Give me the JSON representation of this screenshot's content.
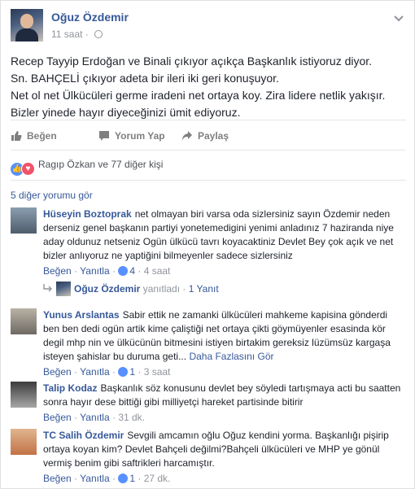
{
  "post": {
    "author": "Oğuz Özdemir",
    "time": "11 saat",
    "dot": "·",
    "lines": [
      "Recep Tayyip Erdoğan ve Binali çıkıyor açıkça Başkanlık istiyoruz diyor.",
      "Sn. BAHÇELİ çıkıyor adeta bir ileri iki geri konuşuyor.",
      "Net ol net Ülkücüleri germe iradeni net ortaya koy. Zira lidere netlik yakışır.",
      "Bizler yinede hayır diyeceğinizi ümit ediyoruz."
    ]
  },
  "actions": {
    "like": "Beğen",
    "comment": "Yorum Yap",
    "share": "Paylaş"
  },
  "reactions": {
    "names": "Ragıp Özkan ve 77 diğer kişi"
  },
  "more_comments": "5 diğer yorumu gör",
  "comments": [
    {
      "name": "Hüseyin Boztoprak",
      "text": "net olmayan biri varsa oda sizlersiniz sayın Özdemir neden derseniz genel başkanın partiyi yonetemedigini yenimi anladınız 7 haziranda niye aday oldunuz netseniz Ogün ülkücü tavrı koyacaktiniz Devlet Bey çok açık ve net bizler anlıyoruz ne yaptiğini bilmeyenler sadece sizlersiniz",
      "like": "Beğen",
      "reply": "Yanıtla",
      "likes": "4",
      "time": "4 saat",
      "sep": "·"
    },
    {
      "name": "Yunus Arslantas",
      "text": "Sabir ettik ne zamanki ülkücüleri mahkeme kapisina gönderdi ben ben dedi ogün artik kime çaliştiği net ortaya çikti göymüyenler esasinda kör degil mhp nin ve ülkücünün bitmesini istiyen birtakim gereksiz lüzümsüz kargaşa isteyen şahislar bu duruma geti...",
      "more": "Daha Fazlasını Gör",
      "like": "Beğen",
      "reply": "Yanıtla",
      "likes": "1",
      "time": "3 saat",
      "sep": "·"
    },
    {
      "name": "Talip Kodaz",
      "text": "Başkanlık söz konusunu devlet bey söyledi tartışmaya acti bu saatten sonra hayır dese bittiği gibi milliyetçi hareket partisinde bitirir",
      "like": "Beğen",
      "reply": "Yanıtla",
      "time": "31 dk.",
      "sep": "·"
    },
    {
      "name": "TC Salih Özdemir",
      "text": "Sevgili amcamın oğlu Oğuz kendini yorma. Başkanlığı pişirip ortaya koyan kim? Devlet Bahçeli değilmi?Bahçeli ülkücüleri ve MHP ye gönül vermiş benim gibi saftrikleri harcamıştır.",
      "like": "Beğen",
      "reply": "Yanıtla",
      "likes": "1",
      "time": "27 dk.",
      "sep": "·"
    }
  ],
  "reply": {
    "name": "Oğuz Özdemir",
    "label": "yanıtladı",
    "dot": "·",
    "count": "1 Yanıt"
  },
  "colors": {
    "link": "#365899",
    "meta": "#90949c",
    "like_blue": "#5890ff",
    "love_red": "#f25268"
  }
}
